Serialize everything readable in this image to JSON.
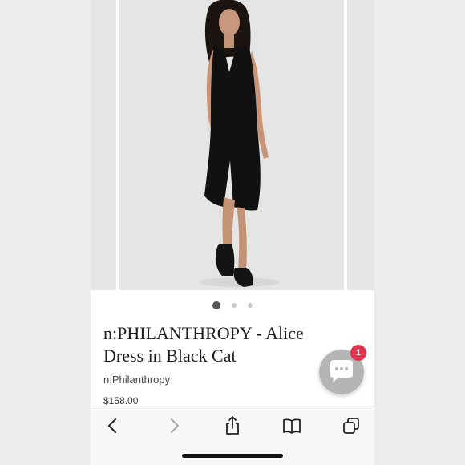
{
  "product": {
    "title_line1": "n:PHILANTHROPY - Alice",
    "title_line2": "Dress in Black Cat",
    "vendor": "n:Philanthropy",
    "price": "$158.00"
  },
  "carousel": {
    "dot_count": 3,
    "active_index": 0,
    "main_image": "model wearing black sleeveless midi dress with black slide sandals"
  },
  "chat": {
    "icon": "chat-bubble-icon",
    "badge_count": "1"
  },
  "toolbar": {
    "icons": [
      "back-icon",
      "forward-icon",
      "share-icon",
      "bookmarks-icon",
      "tabs-icon"
    ]
  },
  "colors": {
    "badge": "#e0344c",
    "chat_button": "#b5b5b5",
    "photo_background": "#e5e5e5"
  }
}
